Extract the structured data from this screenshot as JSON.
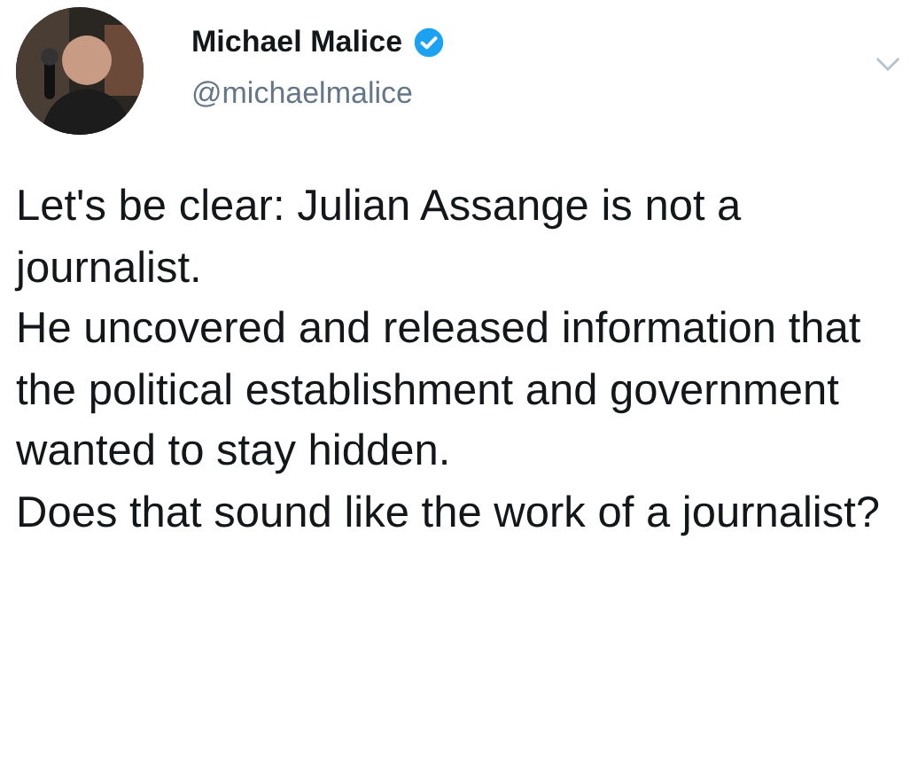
{
  "tweet": {
    "author": {
      "name": "Michael Malice",
      "verified": true,
      "handle": "@michaelmalice"
    },
    "paragraphs": [
      "Let's be clear: Julian Assange is not a journalist.",
      "He uncovered and released information that the political establishment and government wanted to stay hidden.",
      "Does that sound like the work of a journalist?"
    ]
  }
}
